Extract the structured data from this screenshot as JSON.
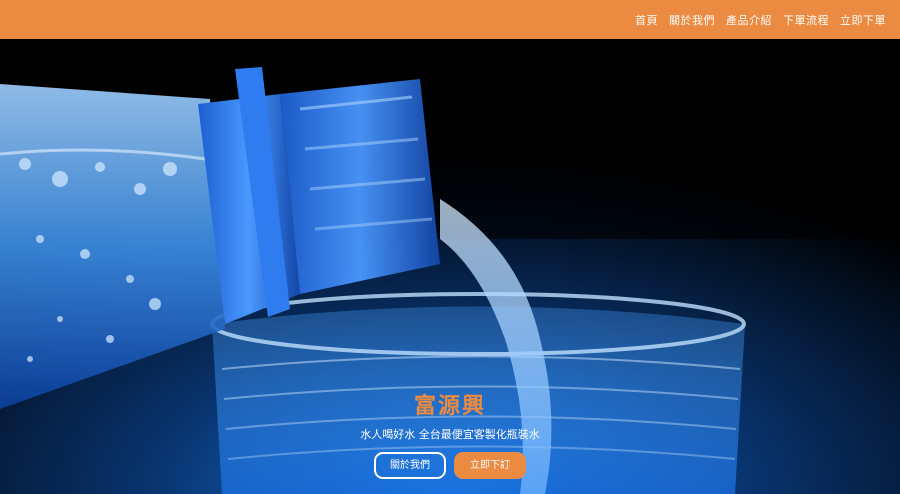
{
  "nav": {
    "items": [
      {
        "label": "首頁"
      },
      {
        "label": "關於我們"
      },
      {
        "label": "產品介紹"
      },
      {
        "label": "下單流程"
      },
      {
        "label": "立即下單"
      }
    ]
  },
  "hero": {
    "title": "富源興",
    "subtitle": "水人喝好水 全台最便宜客製化瓶裝水",
    "buttons": {
      "about_label": "關於我們",
      "order_label": "立即下訂"
    }
  },
  "colors": {
    "accent": "#eb8a41",
    "bottle_blue": "#1f6fd6",
    "background": "#000000"
  }
}
